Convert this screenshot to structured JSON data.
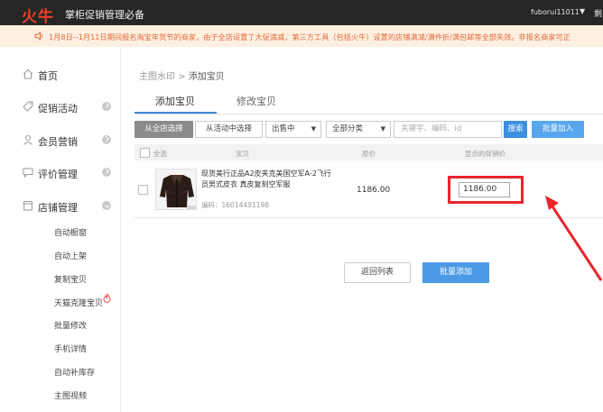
{
  "header": {
    "logo": "火牛",
    "title": "掌柜促销管理必备",
    "username": "fuborui11011",
    "user_caret": "▼",
    "logout": "剩"
  },
  "notice": {
    "icon": "speaker-icon",
    "text": "1月8日--1月11日期间报名淘宝年货节的商家，由于全店设置了大促満减，第三方工具（包括火牛）设置的店铺满减/满件折/满包邮等全部失效。非报名商家可正"
  },
  "sidebar": {
    "items": [
      {
        "label": "首页",
        "icon": "home-icon"
      },
      {
        "label": "促销活动",
        "icon": "tag-icon"
      },
      {
        "label": "会员营销",
        "icon": "user-icon"
      },
      {
        "label": "评价管理",
        "icon": "chat-icon"
      },
      {
        "label": "店铺管理",
        "icon": "store-icon"
      }
    ],
    "sub_items": [
      "自动橱窗",
      "自动上架",
      "复制宝贝",
      "天猫克隆宝贝",
      "批量修改",
      "手机详情",
      "自动补库存",
      "主图视频"
    ]
  },
  "breadcrumb": {
    "parent": "主图水印",
    "separator": ">",
    "current": "添加宝贝"
  },
  "tabs": [
    {
      "label": "添加宝贝",
      "active": true
    },
    {
      "label": "修改宝贝",
      "active": false
    }
  ],
  "toolbar": {
    "store_select": "从全店选择",
    "activity_select": "从活动中选择",
    "status_select": "出售中",
    "category_select": "全部分类",
    "search_placeholder": "关键字、编码、id",
    "search_button": "搜索",
    "batch_join_button": "批量加入"
  },
  "table": {
    "headers": {
      "select_all": "全选",
      "item": "宝贝",
      "orig_price": "原价",
      "display_price": "显示的促销价"
    },
    "rows": [
      {
        "title": "现货美行正品A2皮夹克美国空军A-2飞行员男式皮衣 真皮复刻空军服",
        "code_label": "编码：",
        "code": "16014491198",
        "orig_price": "1186.00",
        "promo_price": "1186.00"
      }
    ]
  },
  "footer": {
    "back_button": "返回列表",
    "batch_add_button": "批量添加"
  },
  "colors": {
    "accent": "#3d8fe0",
    "highlight": "#e8262b",
    "logo": "#e8402a"
  }
}
